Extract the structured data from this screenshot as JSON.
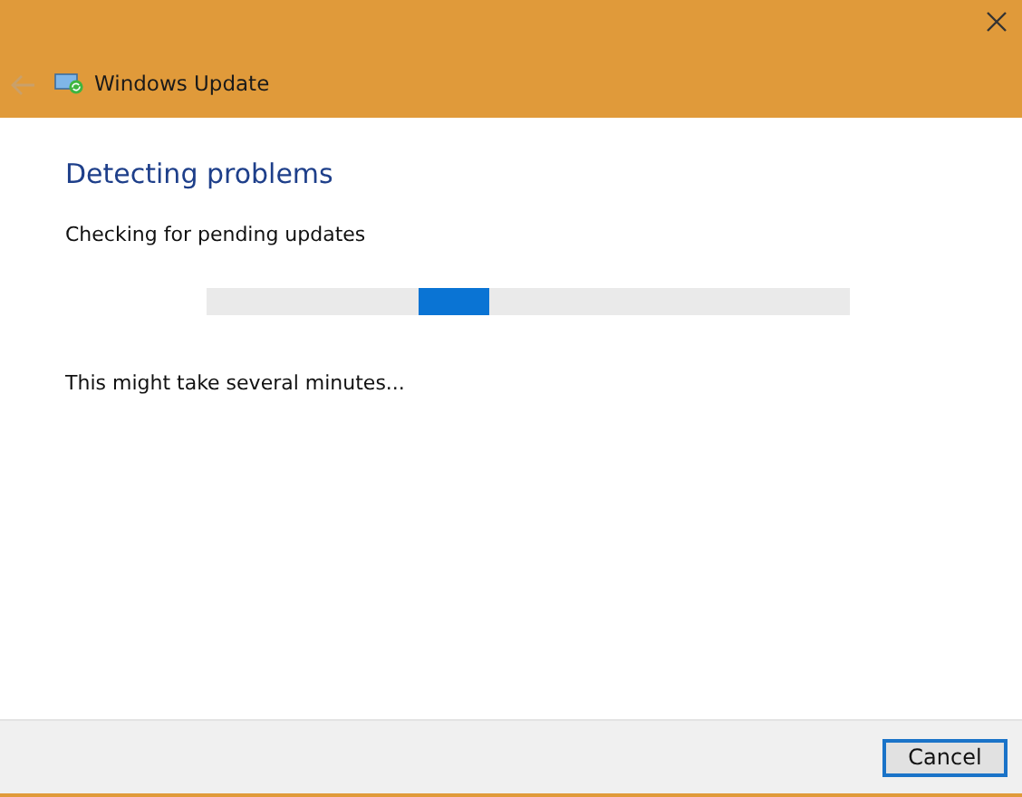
{
  "window": {
    "title": "Windows Update",
    "back_disabled": true
  },
  "heading": "Detecting problems",
  "status": "Checking for pending updates",
  "progress": {
    "kind": "indeterminate"
  },
  "note": "This might take several minutes...",
  "buttons": [
    {
      "label": "Cancel",
      "default": true
    }
  ]
}
